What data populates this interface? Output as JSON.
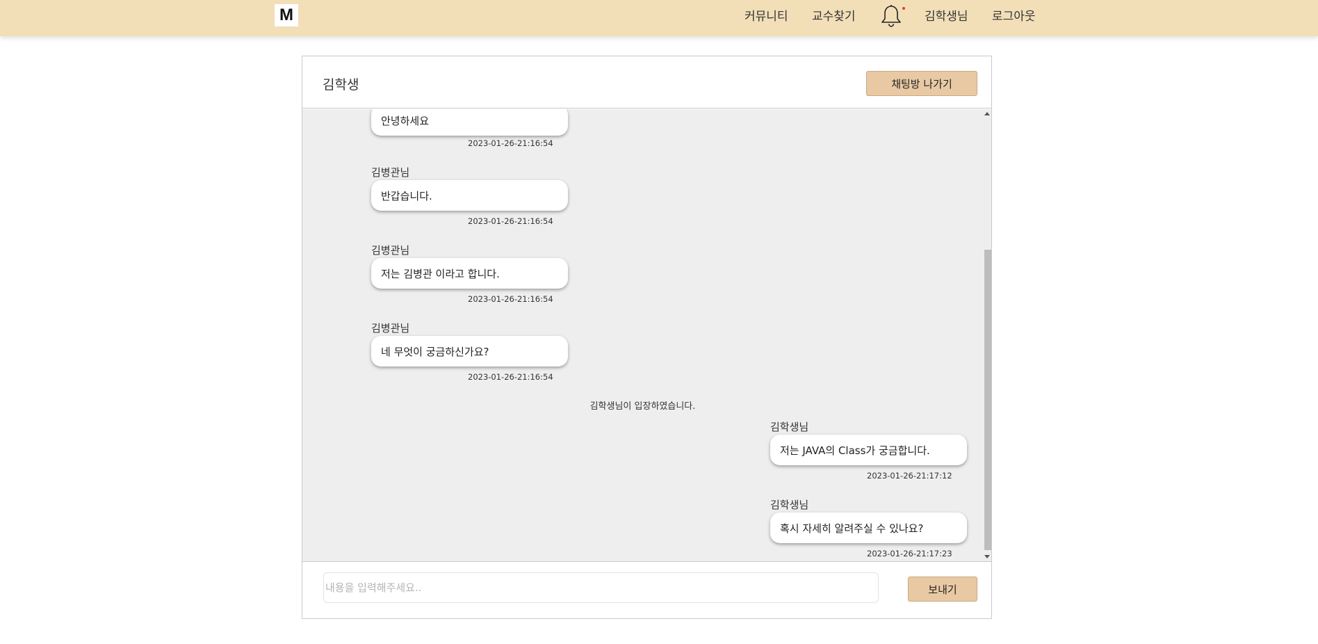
{
  "nav": {
    "logo": "M",
    "items": [
      "커뮤니티",
      "교수찾기",
      "김학생님",
      "로그아웃"
    ],
    "bell_icon": "bell-icon",
    "notification_dot_color": "#e53935"
  },
  "room": {
    "title": "김학생",
    "leave_label": "채팅방 나가기"
  },
  "messages": [
    {
      "sender": "",
      "text": "안녕하세요",
      "time": "2023-01-26-21:16:54"
    },
    {
      "sender": "김병관님",
      "text": "반갑습니다.",
      "time": "2023-01-26-21:16:54"
    },
    {
      "sender": "김병관님",
      "text": "저는 김병관 이라고 합니다.",
      "time": "2023-01-26-21:16:54"
    },
    {
      "sender": "김병관님",
      "text": "네 무엇이 궁금하신가요?",
      "time": "2023-01-26-21:16:54"
    },
    {
      "sender": "김학생님",
      "text": "저는 JAVA의 Class가 궁금합니다.",
      "time": "2023-01-26-21:17:12"
    },
    {
      "sender": "김학생님",
      "text": "혹시 자세히 알려주실 수 있나요?",
      "time": "2023-01-26-21:17:23"
    }
  ],
  "system_message": "김학생님이 입장하였습니다.",
  "composer": {
    "placeholder": "내용을 입력해주세요..",
    "value": "",
    "send_label": "보내기"
  },
  "colors": {
    "nav_bg": "#f2dfb8",
    "button_bg": "#e9c9a4",
    "chat_bg": "#eeeeee"
  }
}
